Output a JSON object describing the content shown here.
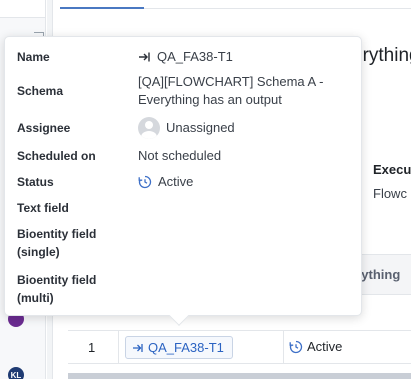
{
  "sidebar": {
    "avatars": [
      {
        "initials": "",
        "color": "#6b2c91"
      },
      {
        "initials": "KL",
        "color": "#1f3b73"
      }
    ]
  },
  "background": {
    "title_fragment": "erything",
    "exec_header_fragment": "Execu",
    "exec_value_fragment": "Flowc",
    "table": {
      "header_fragment": "erything",
      "rows": [
        {
          "index": "1",
          "run_name": "QA_FA38-T1",
          "status": "Active"
        }
      ]
    }
  },
  "popover": {
    "fields": [
      {
        "label": "Name",
        "value": "QA_FA38-T1"
      },
      {
        "label": "Schema",
        "value": "[QA][FLOWCHART] Schema A - Everything has an output"
      },
      {
        "label": "Assignee",
        "value": "Unassigned"
      },
      {
        "label": "Scheduled on",
        "value": "Not scheduled"
      },
      {
        "label": "Status",
        "value": "Active"
      },
      {
        "label": "Text field",
        "value": ""
      },
      {
        "label": "Bioentity field (single)",
        "value": ""
      },
      {
        "label": "Bioentity field (multi)",
        "value": ""
      }
    ]
  },
  "colors": {
    "link": "#2b63c2",
    "status_icon": "#3d6fc7"
  }
}
